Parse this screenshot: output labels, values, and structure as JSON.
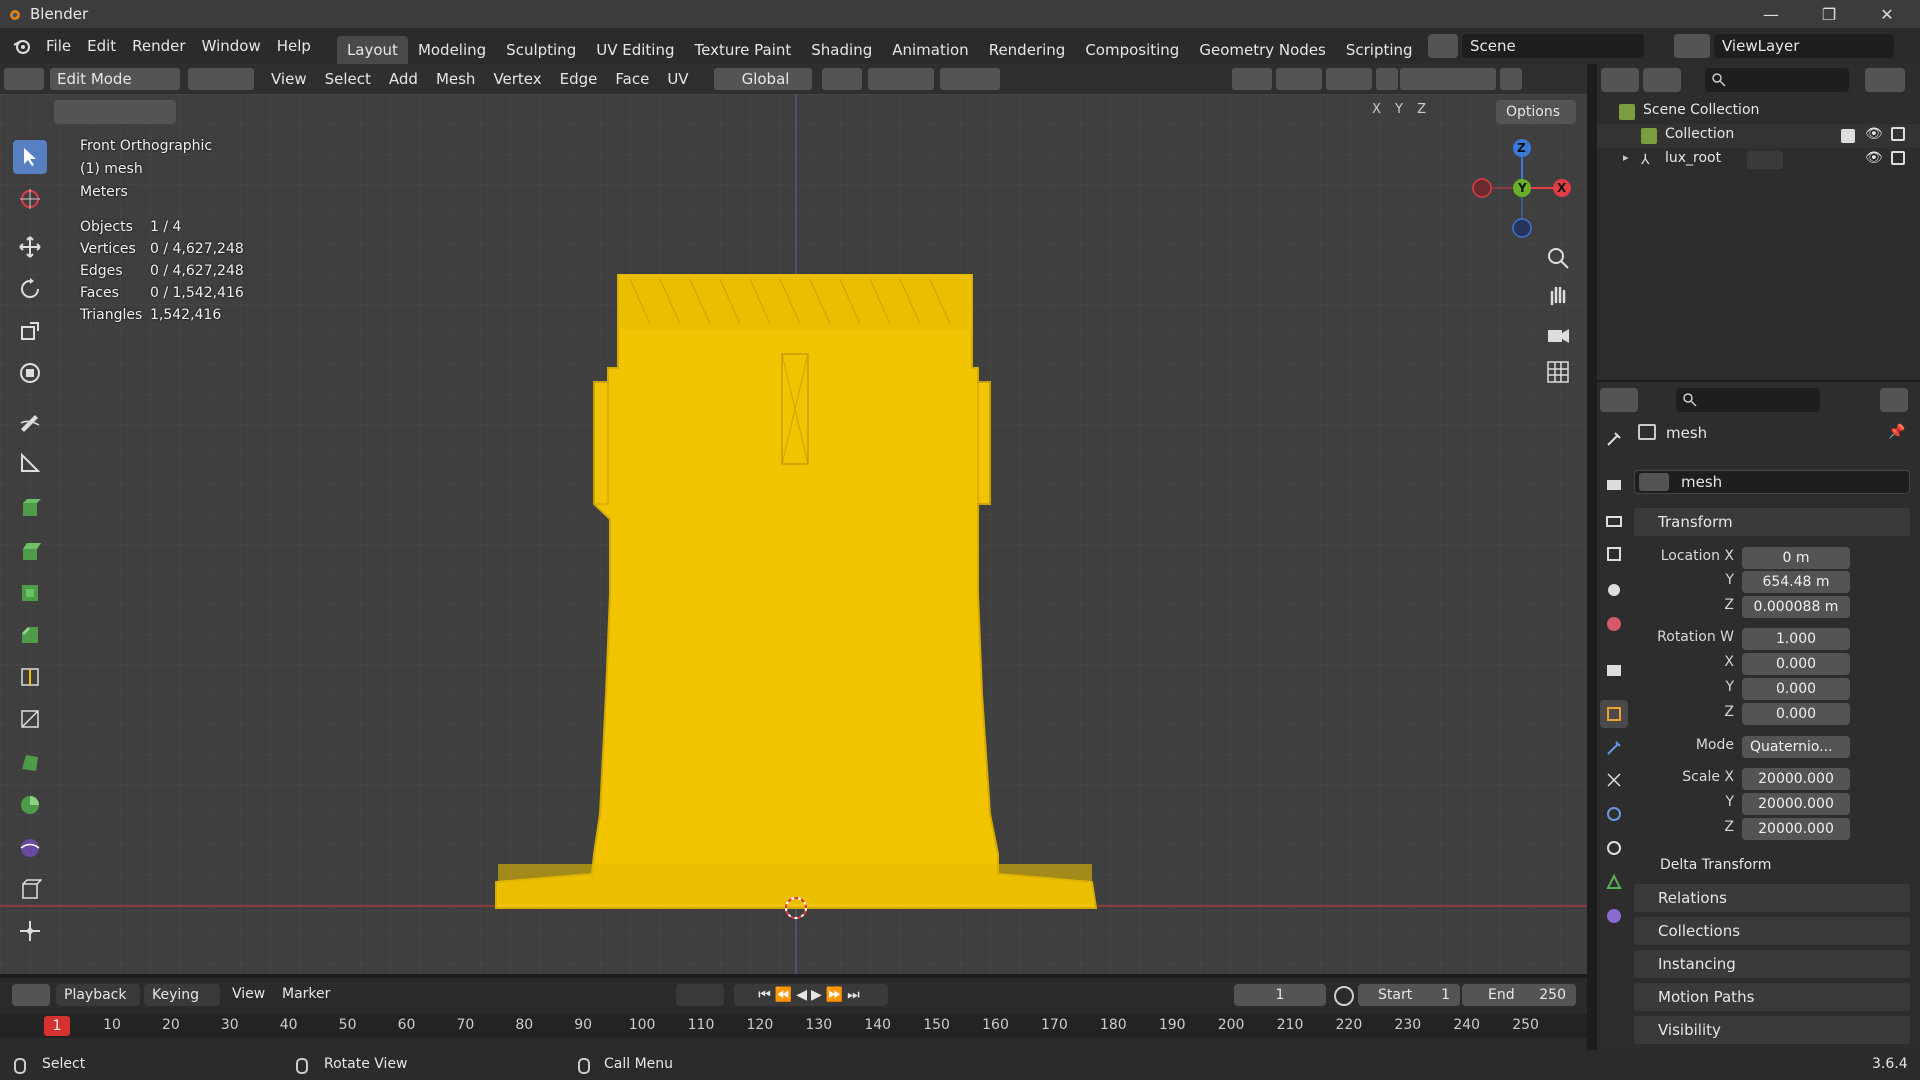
{
  "window": {
    "title": "Blender",
    "version": "3.6.4",
    "minimize": "—",
    "maximize": "❐",
    "close": "✕"
  },
  "menu": {
    "items": [
      "File",
      "Edit",
      "Render",
      "Window",
      "Help"
    ]
  },
  "workspaces": [
    "Layout",
    "Modeling",
    "Sculpting",
    "UV Editing",
    "Texture Paint",
    "Shading",
    "Animation",
    "Rendering",
    "Compositing",
    "Geometry Nodes",
    "Scripting"
  ],
  "workspace_add": "+",
  "scene": {
    "name": "Scene"
  },
  "viewlayer": {
    "name": "ViewLayer"
  },
  "viewport_header": {
    "mode": "Edit Mode",
    "menus": [
      "View",
      "Select",
      "Add",
      "Mesh",
      "Vertex",
      "Edge",
      "Face",
      "UV"
    ],
    "orientation": "Global",
    "options": "Options",
    "axes": [
      "X",
      "Y",
      "Z"
    ]
  },
  "overlay": {
    "view_name": "Front Orthographic",
    "object_line": "(1) mesh",
    "units": "Meters",
    "stats": [
      {
        "label": "Objects",
        "value": "1 / 4"
      },
      {
        "label": "Vertices",
        "value": "0 / 4,627,248"
      },
      {
        "label": "Edges",
        "value": "0 / 4,627,248"
      },
      {
        "label": "Faces",
        "value": "0 / 1,542,416"
      },
      {
        "label": "Triangles",
        "value": "1,542,416"
      }
    ]
  },
  "gizmo": {
    "z": "Z",
    "y": "Y",
    "x": "X"
  },
  "outliner": {
    "root": "Scene Collection",
    "items": [
      {
        "name": "Collection"
      },
      {
        "name": "lux_root"
      }
    ]
  },
  "properties": {
    "object_name": "mesh",
    "datablock": "mesh",
    "transform_title": "Transform",
    "location": {
      "label": "Location X",
      "x": "0 m",
      "y": "654.48 m",
      "z": "0.000088 m"
    },
    "rotation": {
      "label": "Rotation W",
      "w": "1.000",
      "x": "0.000",
      "y": "0.000",
      "z": "0.000"
    },
    "mode_label": "Mode",
    "mode_value": "Quaternio...",
    "scale": {
      "label": "Scale X",
      "x": "20000.000",
      "y": "20000.000",
      "z": "20000.000"
    },
    "axis_y": "Y",
    "axis_z": "Z",
    "axis_x": "X",
    "delta": "Delta Transform",
    "panels": [
      "Relations",
      "Collections",
      "Instancing",
      "Motion Paths",
      "Visibility"
    ]
  },
  "timeline": {
    "menus": [
      "Playback",
      "Keying",
      "View",
      "Marker"
    ],
    "current_frame": "1",
    "start_label": "Start",
    "start": "1",
    "end_label": "End",
    "end": "250",
    "ticks": [
      "10",
      "20",
      "30",
      "40",
      "50",
      "60",
      "70",
      "80",
      "90",
      "100",
      "110",
      "120",
      "130",
      "140",
      "150",
      "160",
      "170",
      "180",
      "190",
      "200",
      "210",
      "220",
      "230",
      "240",
      "250"
    ],
    "playhead": "1"
  },
  "status": {
    "items": [
      "Select",
      "Rotate View",
      "Call Menu"
    ]
  },
  "colors": {
    "accent": "#5680c2",
    "mesh": "#f2c400",
    "axis_x": "#e23c44",
    "axis_y": "#68b025",
    "axis_z": "#3c78d8"
  }
}
